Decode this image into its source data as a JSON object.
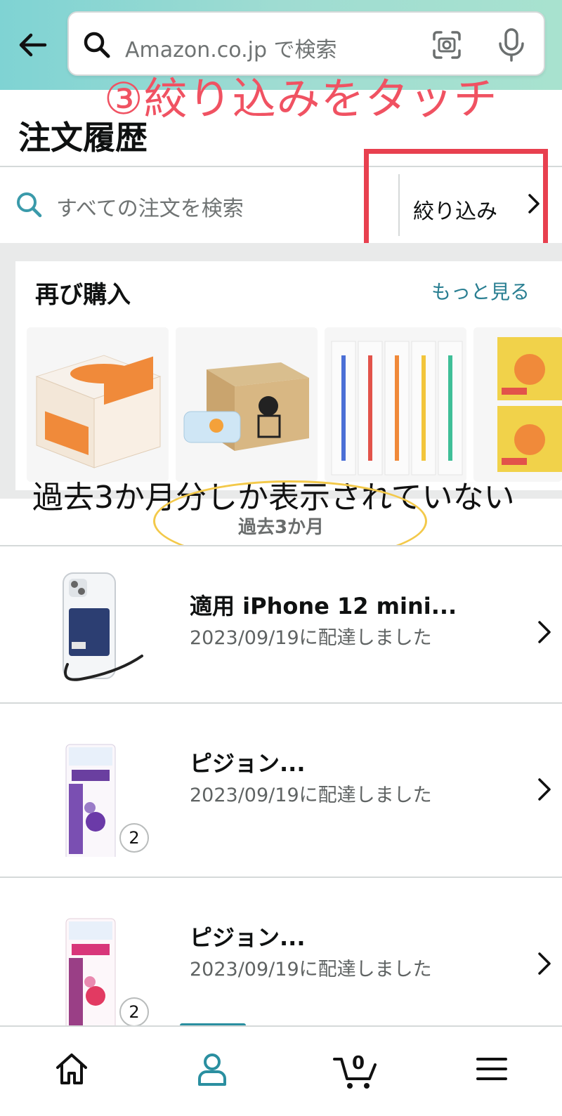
{
  "header": {
    "search_placeholder": "Amazon.co.jp で検索"
  },
  "annotations": {
    "top": "③絞り込みをタッチ",
    "middle": "過去3か月分しか表示されていない"
  },
  "page_title": "注文履歴",
  "order_search": {
    "placeholder": "すべての注文を検索",
    "filter_label": "絞り込み"
  },
  "buy_again": {
    "title": "再び購入",
    "see_more": "もっと見る",
    "items": [
      {
        "icon": "tissue-box-product-image"
      },
      {
        "icon": "wipes-box-product-image"
      },
      {
        "icon": "toothbrushes-product-image"
      },
      {
        "icon": "notebook-product-image"
      }
    ]
  },
  "range_label": "過去3か月",
  "orders": [
    {
      "name": "適用 iPhone 12 mini...",
      "date": "2023/09/19に配達しました",
      "qty": ""
    },
    {
      "name": "ピジョン...",
      "date": "2023/09/19に配達しました",
      "qty": "2"
    },
    {
      "name": "ピジョン...",
      "date": "2023/09/19に配達しました",
      "qty": "2"
    }
  ],
  "bottom_nav": {
    "cart_count": "0",
    "items": [
      "home-icon",
      "account-icon",
      "cart-icon",
      "menu-icon"
    ]
  },
  "colors": {
    "annotation_red": "#f05262",
    "link_teal": "#2a7f92",
    "highlight_yellow": "#f3c94a"
  }
}
